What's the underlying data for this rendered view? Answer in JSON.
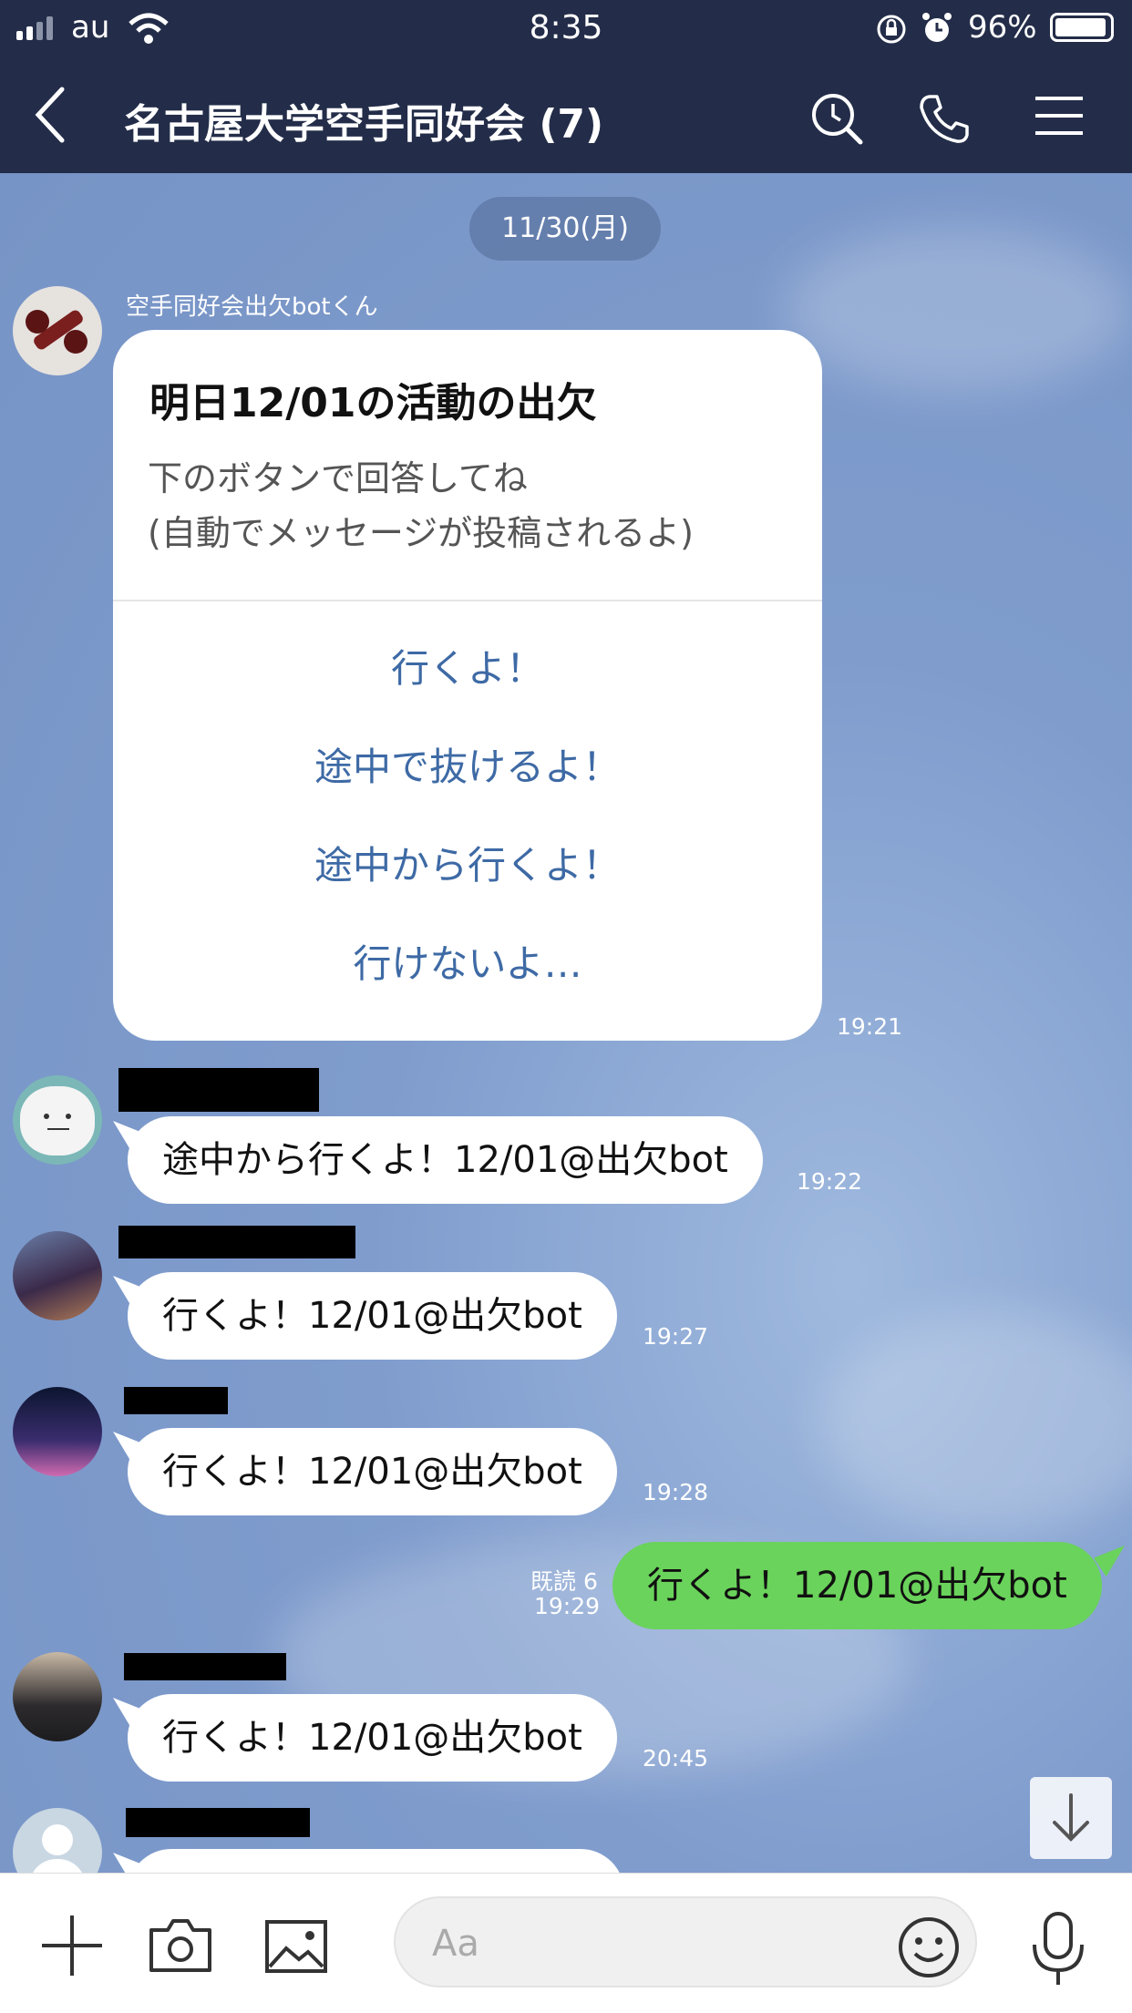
{
  "status": {
    "carrier": "au",
    "time": "8:35",
    "battery": "96%"
  },
  "header": {
    "title": "名古屋大学空手同好会 (7)"
  },
  "chat": {
    "date": "11/30(月)",
    "bot": {
      "name": "空手同好会出欠botくん",
      "card_title": "明日12/01の活動の出欠",
      "card_text_1": "下のボタンで回答してね",
      "card_text_2": "(自動でメッセージが投稿されるよ)",
      "buttons": [
        "行くよ！",
        "途中で抜けるよ！",
        "途中から行くよ！",
        "行けないよ…"
      ],
      "time": "19:21"
    },
    "messages": [
      {
        "text": "途中から行くよ！12/01@出欠bot",
        "time": "19:22"
      },
      {
        "text": "行くよ！12/01@出欠bot",
        "time": "19:27"
      },
      {
        "text": "行くよ！12/01@出欠bot",
        "time": "19:28"
      },
      {
        "text": "行くよ！12/01@出欠bot",
        "time": "19:29",
        "read": "既読 6",
        "mine": true
      },
      {
        "text": "行くよ！12/01@出欠bot",
        "time": "20:45"
      }
    ]
  },
  "input": {
    "placeholder": "Aa"
  },
  "colors": {
    "header_bg": "#232d49",
    "chat_bg": "#7f9ccd",
    "my_bubble": "#6ad35b",
    "card_button_text": "#3e6aa5"
  },
  "icons": [
    "back-icon",
    "search-icon",
    "phone-icon",
    "menu-icon",
    "plus-icon",
    "camera-icon",
    "image-icon",
    "emoji-icon",
    "mic-icon",
    "arrow-down-icon"
  ]
}
